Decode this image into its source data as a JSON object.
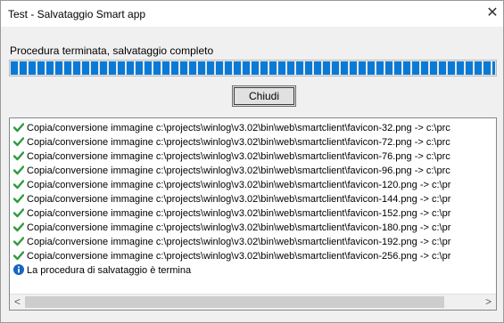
{
  "window": {
    "title": "Test - Salvataggio Smart app"
  },
  "status_text": "Procedura terminata, salvataggio completo",
  "progress": {
    "fraction": 1.0,
    "color": "#0a7ad6"
  },
  "close_button_label": "Chiudi",
  "log": {
    "lines": [
      {
        "icon": "checkmark-icon",
        "text": "Copia/conversione immagine c:\\projects\\winlog\\v3.02\\bin\\web\\smartclient\\favicon-32.png -> c:\\prc"
      },
      {
        "icon": "checkmark-icon",
        "text": "Copia/conversione immagine c:\\projects\\winlog\\v3.02\\bin\\web\\smartclient\\favicon-72.png -> c:\\prc"
      },
      {
        "icon": "checkmark-icon",
        "text": "Copia/conversione immagine c:\\projects\\winlog\\v3.02\\bin\\web\\smartclient\\favicon-76.png -> c:\\prc"
      },
      {
        "icon": "checkmark-icon",
        "text": "Copia/conversione immagine c:\\projects\\winlog\\v3.02\\bin\\web\\smartclient\\favicon-96.png -> c:\\prc"
      },
      {
        "icon": "checkmark-icon",
        "text": "Copia/conversione immagine c:\\projects\\winlog\\v3.02\\bin\\web\\smartclient\\favicon-120.png -> c:\\pr"
      },
      {
        "icon": "checkmark-icon",
        "text": "Copia/conversione immagine c:\\projects\\winlog\\v3.02\\bin\\web\\smartclient\\favicon-144.png -> c:\\pr"
      },
      {
        "icon": "checkmark-icon",
        "text": "Copia/conversione immagine c:\\projects\\winlog\\v3.02\\bin\\web\\smartclient\\favicon-152.png -> c:\\pr"
      },
      {
        "icon": "checkmark-icon",
        "text": "Copia/conversione immagine c:\\projects\\winlog\\v3.02\\bin\\web\\smartclient\\favicon-180.png -> c:\\pr"
      },
      {
        "icon": "checkmark-icon",
        "text": "Copia/conversione immagine c:\\projects\\winlog\\v3.02\\bin\\web\\smartclient\\favicon-192.png -> c:\\pr"
      },
      {
        "icon": "checkmark-icon",
        "text": "Copia/conversione immagine c:\\projects\\winlog\\v3.02\\bin\\web\\smartclient\\favicon-256.png -> c:\\pr"
      },
      {
        "icon": "info-icon",
        "text": "La procedura di salvataggio è termina"
      }
    ]
  },
  "scrollbar": {
    "left_arrow": "<",
    "right_arrow": ">"
  },
  "colors": {
    "check": "#2e9b3e",
    "info": "#1565c0"
  }
}
